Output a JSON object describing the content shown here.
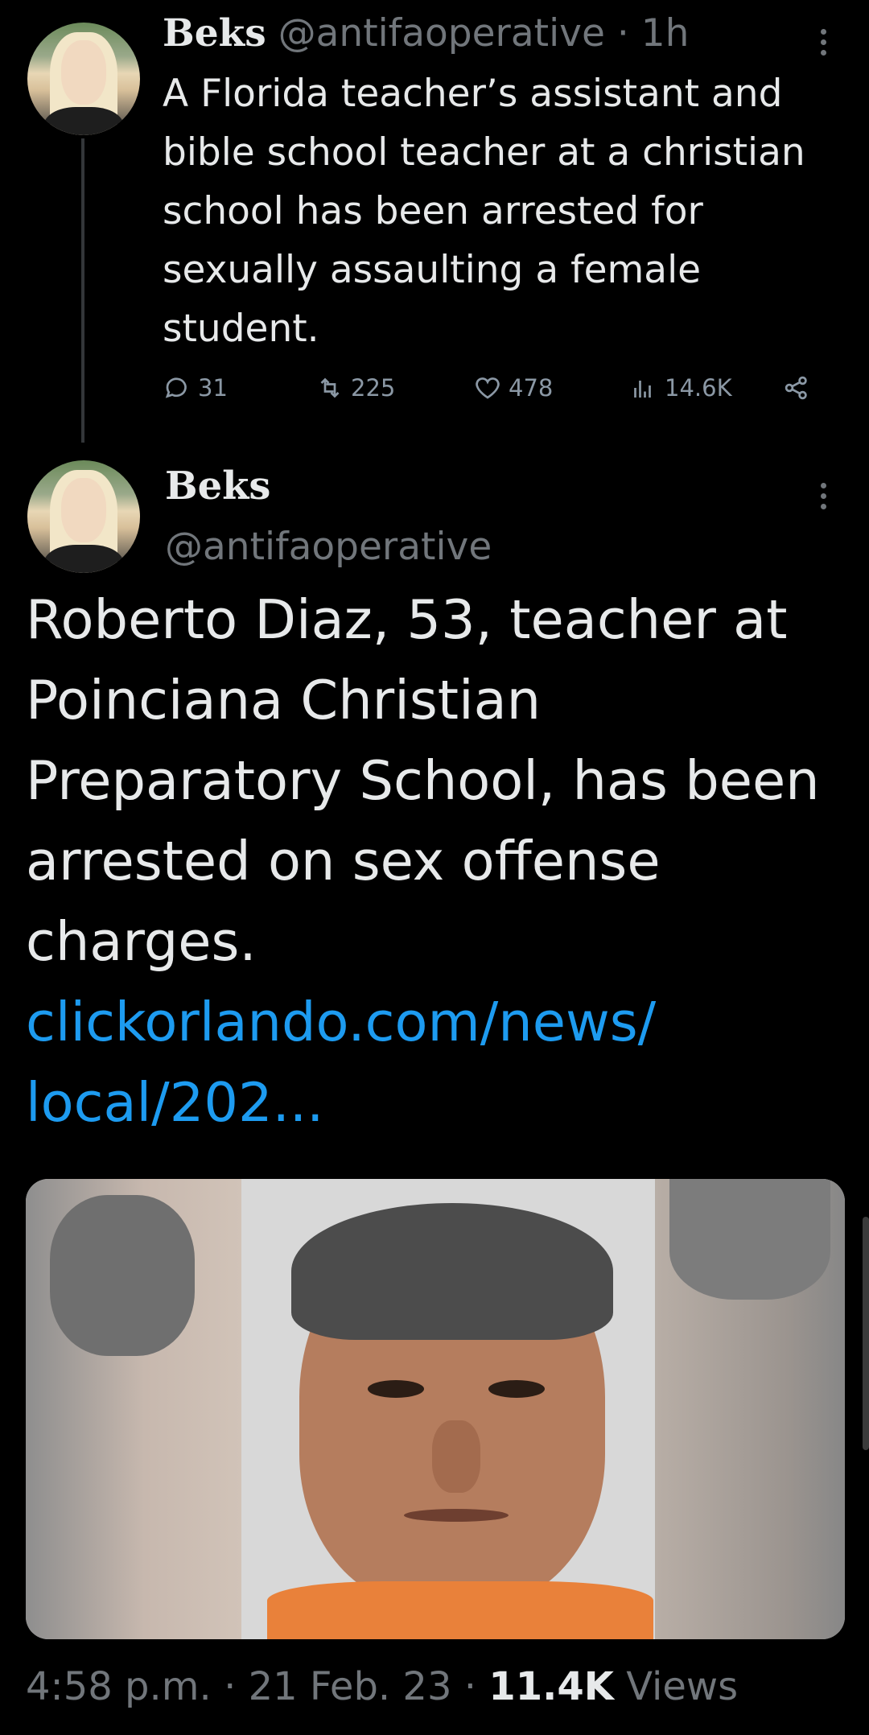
{
  "tweet1": {
    "name": "Beks",
    "handle": "@antifaoperative",
    "sep": "·",
    "time": "1h",
    "text": "A Florida teacher’s assistant and bible school teacher at a christian school has been arrested for sexually assaulting a female student.",
    "replies": "31",
    "retweets": "225",
    "likes": "478",
    "views": "14.6K"
  },
  "tweet2": {
    "name": "Beks",
    "handle": "@antifaoperative",
    "text": "Roberto Diaz, 53, teacher at Poinciana Christian Preparatory School, has been arrested on sex offense charges.",
    "link_line1": "clickorlando.com/news/",
    "link_line2": "local/202...",
    "footer": {
      "time": "4:58 p.m.",
      "sep1": "·",
      "date": "21 Feb. 23",
      "sep2": "·",
      "views_count": "11.4K",
      "views_label": "Views"
    }
  },
  "colors": {
    "background": "#000000",
    "text": "#e7e9ea",
    "muted": "#71767b",
    "link": "#1d9bf0",
    "icon": "#8b98a5"
  },
  "icons": [
    "more-icon",
    "reply-icon",
    "retweet-icon",
    "like-icon",
    "views-icon",
    "share-icon"
  ]
}
